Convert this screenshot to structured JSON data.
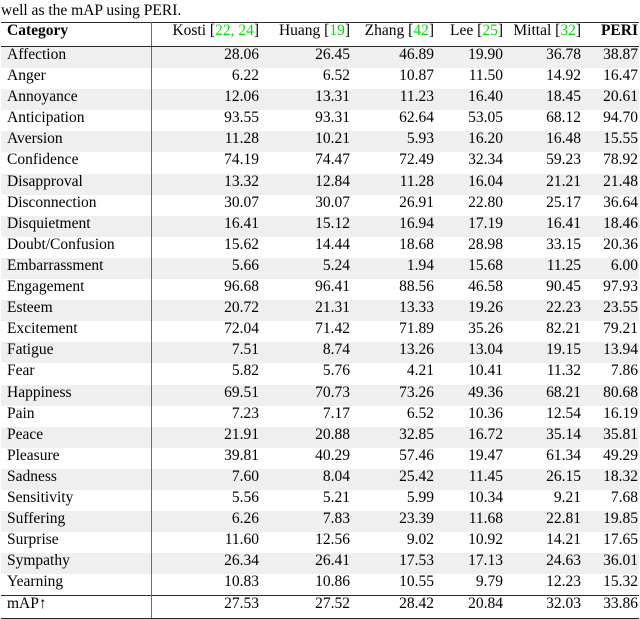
{
  "caption": "well as the mAP using PERI.",
  "table": {
    "columns": [
      {
        "key": "category",
        "label": "Category",
        "bold": true,
        "cite": null
      },
      {
        "key": "kosti",
        "label": "Kosti",
        "cite": "22, 24"
      },
      {
        "key": "huang",
        "label": "Huang",
        "cite": "19"
      },
      {
        "key": "zhang",
        "label": "Zhang",
        "cite": "42"
      },
      {
        "key": "lee",
        "label": "Lee",
        "cite": "25"
      },
      {
        "key": "mittal",
        "label": "Mittal",
        "cite": "32"
      },
      {
        "key": "peri",
        "label": "PERI",
        "cite": null,
        "bold": true
      }
    ],
    "cite_color": "#00e000",
    "shade_color": "#efefef",
    "rows": [
      {
        "category": "Affection",
        "values": [
          "28.06",
          "26.45",
          "46.89",
          "19.90",
          "36.78",
          "38.87"
        ],
        "bold_index": 5
      },
      {
        "category": "Anger",
        "values": [
          "6.22",
          "6.52",
          "10.87",
          "11.50",
          "14.92",
          "16.47"
        ],
        "bold_index": 5
      },
      {
        "category": "Annoyance",
        "values": [
          "12.06",
          "13.31",
          "11.23",
          "16.40",
          "18.45",
          "20.61"
        ],
        "bold_index": 5
      },
      {
        "category": "Anticipation",
        "values": [
          "93.55",
          "93.31",
          "62.64",
          "53.05",
          "68.12",
          "94.70"
        ],
        "bold_index": 5
      },
      {
        "category": "Aversion",
        "values": [
          "11.28",
          "10.21",
          "5.93",
          "16.20",
          "16.48",
          "15.55"
        ],
        "bold_index": 4
      },
      {
        "category": "Confidence",
        "values": [
          "74.19",
          "74.47",
          "72.49",
          "32.34",
          "59.23",
          "78.92"
        ],
        "bold_index": 5
      },
      {
        "category": "Disapproval",
        "values": [
          "13.32",
          "12.84",
          "11.28",
          "16.04",
          "21.21",
          "21.48"
        ],
        "bold_index": 5
      },
      {
        "category": "Disconnection",
        "values": [
          "30.07",
          "30.07",
          "26.91",
          "22.80",
          "25.17",
          "36.64"
        ],
        "bold_index": 5
      },
      {
        "category": "Disquietment",
        "values": [
          "16.41",
          "15.12",
          "16.94",
          "17.19",
          "16.41",
          "18.46"
        ],
        "bold_index": 5
      },
      {
        "category": "Doubt/Confusion",
        "values": [
          "15.62",
          "14.44",
          "18.68",
          "28.98",
          "33.15",
          "20.36"
        ],
        "bold_index": 4
      },
      {
        "category": "Embarrassment",
        "values": [
          "5.66",
          "5.24",
          "1.94",
          "15.68",
          "11.25",
          "6.00"
        ],
        "bold_index": 3
      },
      {
        "category": "Engagement",
        "values": [
          "96.68",
          "96.41",
          "88.56",
          "46.58",
          "90.45",
          "97.93"
        ],
        "bold_index": 5
      },
      {
        "category": "Esteem",
        "values": [
          "20.72",
          "21.31",
          "13.33",
          "19.26",
          "22.23",
          "23.55"
        ],
        "bold_index": 5
      },
      {
        "category": "Excitement",
        "values": [
          "72.04",
          "71.42",
          "71.89",
          "35.26",
          "82.21",
          "79.21"
        ],
        "bold_index": 4
      },
      {
        "category": "Fatigue",
        "values": [
          "7.51",
          "8.74",
          "13.26",
          "13.04",
          "19.15",
          "13.94"
        ],
        "bold_index": 4
      },
      {
        "category": "Fear",
        "values": [
          "5.82",
          "5.76",
          "4.21",
          "10.41",
          "11.32",
          "7.86"
        ],
        "bold_index": 4
      },
      {
        "category": "Happiness",
        "values": [
          "69.51",
          "70.73",
          "73.26",
          "49.36",
          "68.21",
          "80.68"
        ],
        "bold_index": 5
      },
      {
        "category": "Pain",
        "values": [
          "7.23",
          "7.17",
          "6.52",
          "10.36",
          "12.54",
          "16.19"
        ],
        "bold_index": 5
      },
      {
        "category": "Peace",
        "values": [
          "21.91",
          "20.88",
          "32.85",
          "16.72",
          "35.14",
          "35.81"
        ],
        "bold_index": 5
      },
      {
        "category": "Pleasure",
        "values": [
          "39.81",
          "40.29",
          "57.46",
          "19.47",
          "61.34",
          "49.29"
        ],
        "bold_index": 4
      },
      {
        "category": "Sadness",
        "values": [
          "7.60",
          "8.04",
          "25.42",
          "11.45",
          "26.15",
          "18.32"
        ],
        "bold_index": 4
      },
      {
        "category": "Sensitivity",
        "values": [
          "5.56",
          "5.21",
          "5.99",
          "10.34",
          "9.21",
          "7.68"
        ],
        "bold_index": 4
      },
      {
        "category": "Suffering",
        "values": [
          "6.26",
          "7.83",
          "23.39",
          "11.68",
          "22.81",
          "19.85"
        ],
        "bold_index": 4
      },
      {
        "category": "Surprise",
        "values": [
          "11.60",
          "12.56",
          "9.02",
          "10.92",
          "14.21",
          "17.65"
        ],
        "bold_index": 5
      },
      {
        "category": "Sympathy",
        "values": [
          "26.34",
          "26.41",
          "17.53",
          "17.13",
          "24.63",
          "36.01"
        ],
        "bold_index": 5
      },
      {
        "category": "Yearning",
        "values": [
          "10.83",
          "10.86",
          "10.55",
          "9.79",
          "12.23",
          "15.32"
        ],
        "bold_index": 5
      }
    ],
    "total_row": {
      "category": "mAP↑",
      "values": [
        "27.53",
        "27.52",
        "28.42",
        "20.84",
        "32.03",
        "33.86"
      ],
      "bold_index": 5
    }
  }
}
